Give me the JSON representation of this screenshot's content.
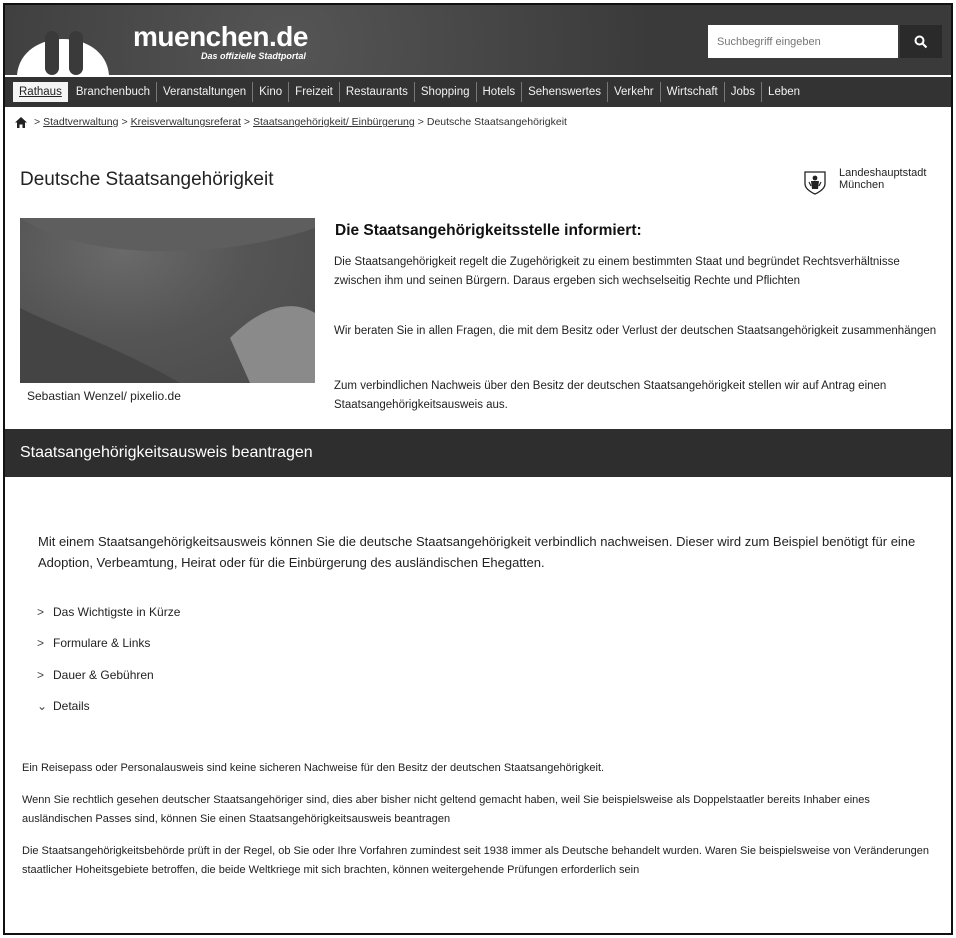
{
  "header": {
    "logo_text": "muenchen.de",
    "logo_sub": "Das offizielle Stadtportal",
    "search_placeholder": "Suchbegriff eingeben",
    "search_icon": "search-icon"
  },
  "nav": {
    "items": [
      "Rathaus",
      "Branchenbuch",
      "Veranstaltungen",
      "Kino",
      "Freizeit",
      "Restaurants",
      "Shopping",
      "Hotels",
      "Sehenswertes",
      "Verkehr",
      "Wirtschaft",
      "Jobs",
      "Leben"
    ]
  },
  "breadcrumb": {
    "home_icon": "home-icon",
    "separator": ">",
    "links": [
      "Stadtverwaltung",
      "Kreisverwaltungsreferat",
      "Staatsangehörigkeit/ Einbürgerung"
    ],
    "current": "Deutsche Staatsangehörigkeit"
  },
  "page": {
    "title": "Deutsche Staatsangehörigkeit",
    "emblem_icon": "city-emblem-icon",
    "city_line1": "Landeshauptstadt",
    "city_line2": "München"
  },
  "hero": {
    "caption": "Sebastian Wenzel/ pixelio.de"
  },
  "intro": {
    "heading": "Die Staatsangehörigkeitsstelle informiert:",
    "p1": "Die Staatsangehörigkeit regelt die Zugehörigkeit zu einem bestimmten Staat und begründet Rechtsverhältnisse zwischen ihm und seinen Bürgern. Daraus ergeben sich wechselseitig Rechte und Pflichten",
    "p2": "Wir beraten Sie in allen Fragen, die mit dem Besitz oder Verlust der deutschen Staatsangehörigkeit zusammenhängen",
    "p3": "Zum verbindlichen Nachweis über den Besitz der deutschen Staatsangehörigkeit stellen wir auf Antrag einen Staatsangehörigkeitsausweis aus."
  },
  "section": {
    "title": "Staatsangehörigkeitsausweis beantragen",
    "lead": "Mit einem Staatsangehörigkeitsausweis können Sie die deutsche Staatsangehörigkeit verbindlich nachweisen. Dieser wird zum Beispiel benötigt für eine Adoption, Verbeamtung, Heirat oder für die Einbürgerung des ausländischen Ehegatten."
  },
  "accordion": {
    "items": [
      {
        "label": "Das Wichtigste in Kürze",
        "chevron": ">"
      },
      {
        "label": "Formulare & Links",
        "chevron": ">"
      },
      {
        "label": "Dauer & Gebühren",
        "chevron": ">"
      },
      {
        "label": "Details",
        "chevron": "⌄"
      }
    ]
  },
  "details": {
    "p1": "Ein Reisepass oder Personalausweis sind keine sicheren Nachweise für den Besitz der deutschen Staatsangehörigkeit.",
    "p2": "Wenn Sie rechtlich gesehen deutscher Staatsangehöriger sind, dies aber bisher nicht geltend gemacht haben, weil Sie beispielsweise als Doppelstaatler bereits Inhaber eines ausländischen Passes sind, können Sie einen Staatsangehörigkeitsausweis beantragen",
    "p3": "Die Staatsangehörigkeitsbehörde prüft in der Regel, ob Sie oder Ihre Vorfahren zumindest seit 1938 immer als Deutsche behandelt wurden. Waren Sie beispielsweise von Veränderungen staatlicher Hoheitsgebiete betroffen, die beide Weltkriege mit sich brachten, können weitergehende Prüfungen erforderlich sein"
  }
}
